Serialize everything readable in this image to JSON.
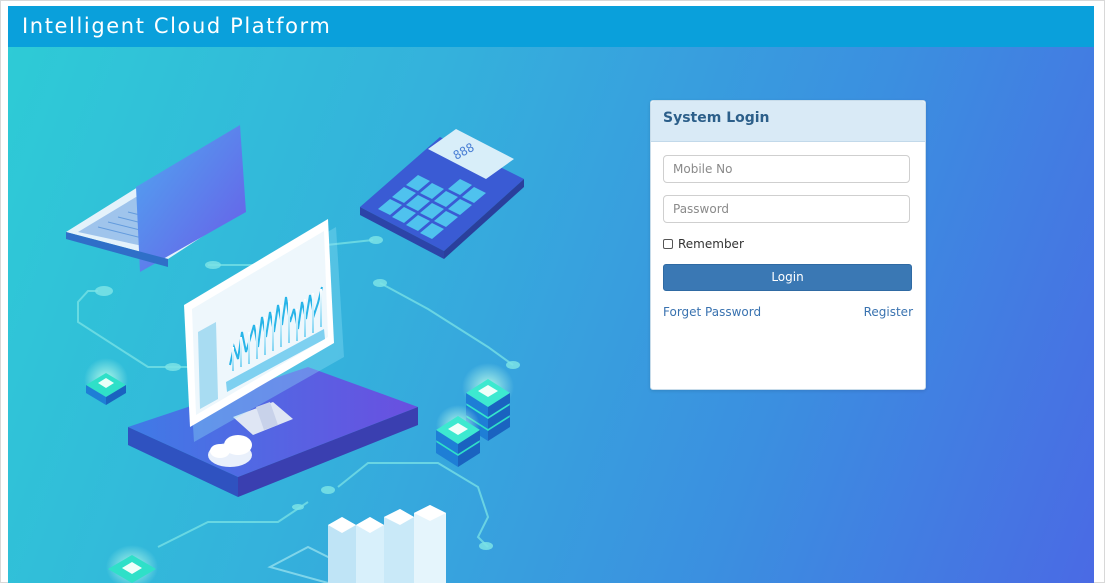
{
  "header": {
    "title": "Intelligent Cloud Platform"
  },
  "login": {
    "title": "System Login",
    "mobile_placeholder": "Mobile No",
    "password_placeholder": "Password",
    "remember_label": "Remember",
    "remember_checked": false,
    "login_label": "Login",
    "forget_label": "Forget Password",
    "register_label": "Register"
  },
  "calculator": {
    "display": "888"
  },
  "colors": {
    "header_bg": "#0aa0db",
    "bg_gradient_start": "#2ecbd6",
    "bg_gradient_end": "#4a6ae4",
    "card_header_bg": "#d9eaf6",
    "button_bg": "#3a78b4",
    "link": "#3a73b0"
  }
}
